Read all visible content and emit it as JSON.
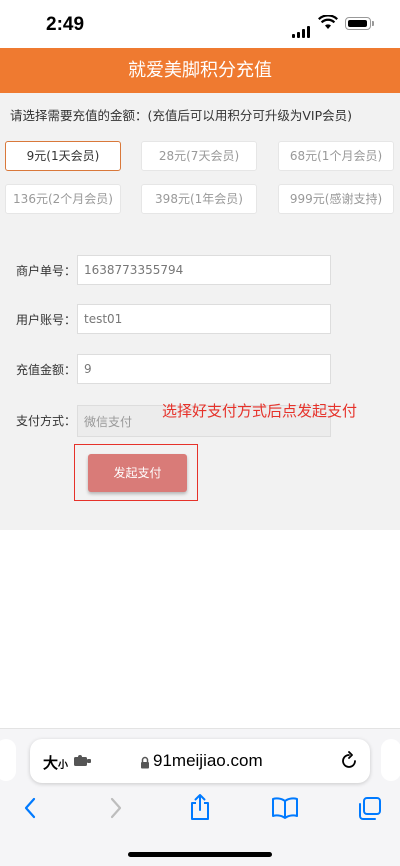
{
  "status_bar": {
    "time": "2:49"
  },
  "header": {
    "title": "就爱美脚积分充值"
  },
  "prompt": "请选择需要充值的金额：(充值后可以用积分可升级为VIP会员)",
  "options": [
    {
      "label": "9元(1天会员)",
      "selected": true
    },
    {
      "label": "28元(7天会员)",
      "selected": false
    },
    {
      "label": "68元(1个月会员)",
      "selected": false
    },
    {
      "label": "136元(2个月会员)",
      "selected": false
    },
    {
      "label": "398元(1年会员)",
      "selected": false
    },
    {
      "label": "999元(感谢支持)",
      "selected": false
    }
  ],
  "form": {
    "merchant_order_label": "商户单号：",
    "merchant_order_value": "1638773355794",
    "user_account_label": "用户账号：",
    "user_account_value": "test01",
    "amount_label": "充值金额：",
    "amount_value": "9",
    "payment_method_label": "支付方式：",
    "payment_method_value": "微信支付"
  },
  "annotation": "选择好支付方式后点发起支付",
  "pay_button": "发起支付",
  "browser": {
    "text_size_big": "大",
    "text_size_small": "小",
    "url": "91meijiao.com"
  },
  "colors": {
    "header": "#ef7a30",
    "pay_button": "#d97b78",
    "annotation": "#e6322a",
    "ios_blue": "#007aff"
  }
}
